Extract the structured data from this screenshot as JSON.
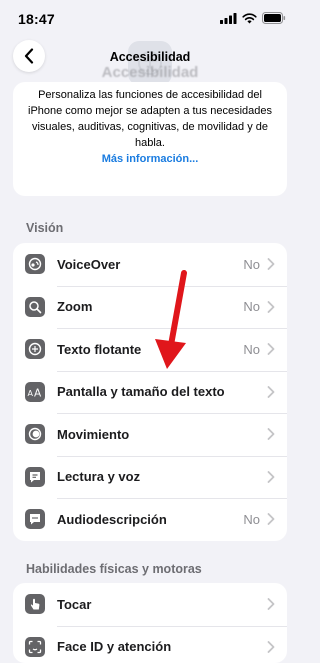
{
  "status": {
    "time": "18:47"
  },
  "header": {
    "title": "Accesibilidad",
    "large_title_ghost": "Accesibilidad"
  },
  "intro": {
    "text": "Personaliza las funciones de accesibilidad del iPhone como mejor se adapten a tus necesidades visuales, auditivas, cognitivas, de movilidad y de habla.",
    "link": "Más información..."
  },
  "sections": {
    "vision": {
      "title": "Visión",
      "items": [
        {
          "label": "VoiceOver",
          "value": "No",
          "icon": "voiceover-icon"
        },
        {
          "label": "Zoom",
          "value": "No",
          "icon": "zoom-icon"
        },
        {
          "label": "Texto flotante",
          "value": "No",
          "icon": "hover-text-icon"
        },
        {
          "label": "Pantalla y tamaño del texto",
          "value": "",
          "icon": "text-size-icon"
        },
        {
          "label": "Movimiento",
          "value": "",
          "icon": "motion-icon"
        },
        {
          "label": "Lectura y voz",
          "value": "",
          "icon": "spoken-content-icon"
        },
        {
          "label": "Audiodescripción",
          "value": "No",
          "icon": "audio-description-icon"
        }
      ]
    },
    "physical": {
      "title": "Habilidades físicas y motoras",
      "items": [
        {
          "label": "Tocar",
          "value": "",
          "icon": "touch-icon"
        },
        {
          "label": "Face ID y atención",
          "value": "",
          "icon": "face-id-icon"
        }
      ]
    }
  },
  "colors": {
    "background": "#f2f2f7",
    "link": "#1a7ce0",
    "icon_bg": "#636366",
    "annotation_arrow": "#e0161b"
  }
}
